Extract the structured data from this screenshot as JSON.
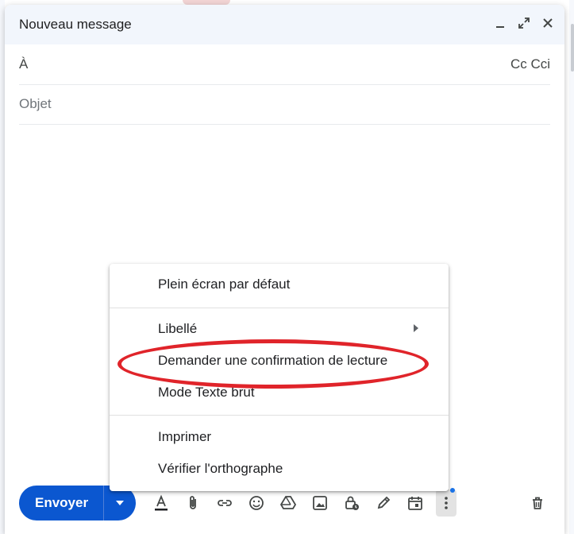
{
  "compose": {
    "title": "Nouveau message",
    "to_label": "À",
    "cc_label": "Cc Cci",
    "subject_placeholder": "Objet",
    "send_label": "Envoyer"
  },
  "menu": {
    "items": [
      {
        "label": "Plein écran par défaut"
      },
      {
        "label": "Libellé"
      },
      {
        "label": "Demander une confirmation de lecture"
      },
      {
        "label": "Mode Texte brut"
      },
      {
        "label": "Imprimer"
      },
      {
        "label": "Vérifier l'orthographe"
      }
    ]
  },
  "icons": {
    "minimize": "minimize-icon",
    "expand": "expand-icon",
    "close": "close-icon",
    "format": "text-format-icon",
    "attach": "attach-icon",
    "link": "link-icon",
    "emoji": "emoji-icon",
    "drive": "drive-icon",
    "photo": "photo-icon",
    "confidential": "lock-clock-icon",
    "signature": "signature-pen-icon",
    "schedule": "calendar-icon",
    "more": "more-options-icon",
    "trash": "trash-icon"
  },
  "colors": {
    "send": "#0b57d0",
    "annotation": "#e0242a",
    "header": "#f2f6fc"
  }
}
